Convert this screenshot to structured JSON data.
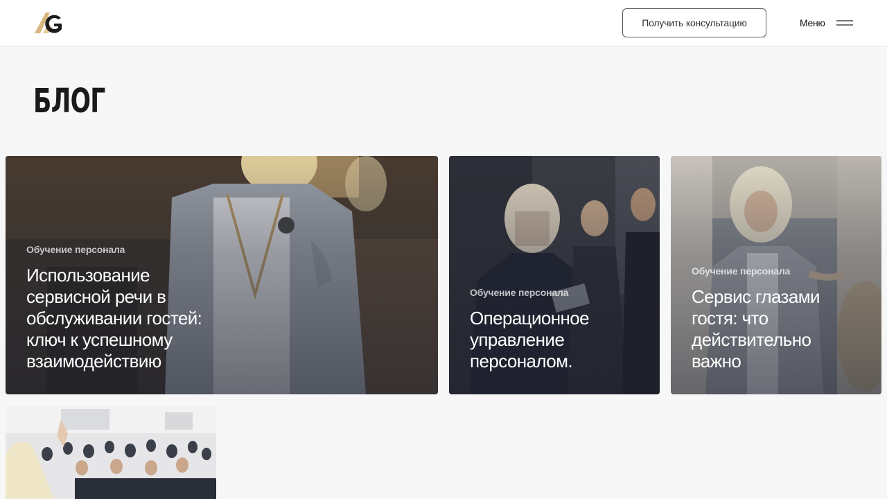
{
  "header": {
    "logo_text": "AG",
    "cta_label": "Получить консультацию",
    "menu_label": "Меню"
  },
  "page": {
    "title": "БЛОГ"
  },
  "posts": [
    {
      "category": "Обучение персонала",
      "title": "Использование сервисной речи в обслуживании гостей: ключ к успешному взаимодействию"
    },
    {
      "category": "Обучение персонала",
      "title": "Операционное управление персоналом."
    },
    {
      "category": "Обучение персонала",
      "title": "Сервис глазами гостя: что действительно важно"
    },
    {
      "category": "",
      "title": ""
    }
  ],
  "colors": {
    "background": "#f7f7f7",
    "header_bg": "#ffffff",
    "logo_gold": "#d9b67d",
    "logo_dark": "#1c1c1c",
    "text_dark": "#1a1a1a"
  }
}
